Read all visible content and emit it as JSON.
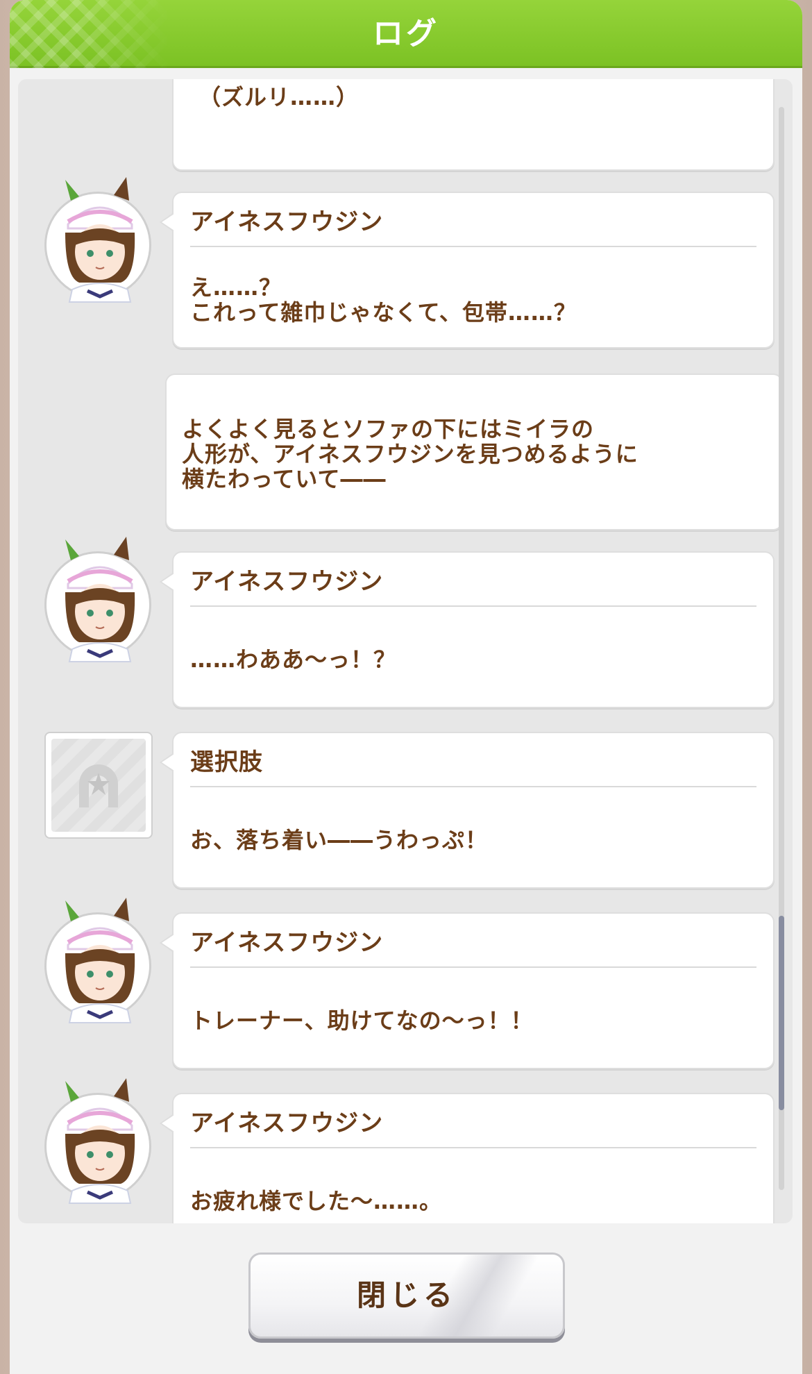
{
  "header": {
    "title": "ログ"
  },
  "entries": [
    {
      "type": "narration",
      "text": "（ズルリ……）"
    },
    {
      "type": "dialogue",
      "speaker": "アイネスフウジン",
      "text": "え……？\nこれって雑巾じゃなくて、包帯……？"
    },
    {
      "type": "narration",
      "text": "よくよく見るとソファの下にはミイラの\n人形が、アイネスフウジンを見つめるように\n横たわっていて――"
    },
    {
      "type": "dialogue",
      "speaker": "アイネスフウジン",
      "text": "……わああ～っ！？"
    },
    {
      "type": "choice",
      "speaker": "選択肢",
      "text": "お、落ち着い――うわっぷ！"
    },
    {
      "type": "dialogue",
      "speaker": "アイネスフウジン",
      "text": "トレーナー、助けてなの～っ！！"
    },
    {
      "type": "dialogue",
      "speaker": "アイネスフウジン",
      "text": "お疲れ様でした～……。"
    }
  ],
  "icons": {
    "avatar": "character-portrait-icon",
    "choice": "horseshoe-star-icon"
  },
  "footer": {
    "close_label": "閉じる"
  },
  "colors": {
    "header_green": "#8ccf2f",
    "text_brown": "#6b3d18"
  }
}
